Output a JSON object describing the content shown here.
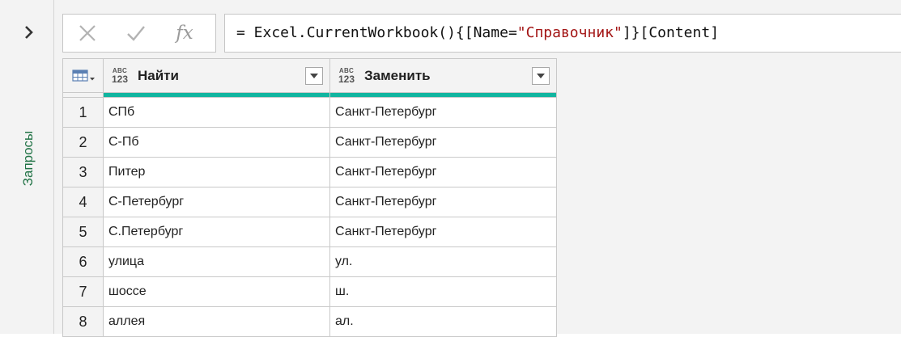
{
  "sidebar": {
    "label": "Запросы",
    "expand_icon": "chevron-right-icon"
  },
  "formula_bar": {
    "cancel_icon": "close-icon",
    "accept_icon": "check-icon",
    "fx_label": "fx",
    "prefix": "= Excel.CurrentWorkbook(){[Name=",
    "string_literal": "\"Справочник\"",
    "suffix": "]}[Content]"
  },
  "table": {
    "corner_icon": "table-menu-icon",
    "type_icon_top": "ABC",
    "type_icon_bottom": "123",
    "columns": [
      {
        "name": "Найти"
      },
      {
        "name": "Заменить"
      }
    ],
    "rows": [
      {
        "n": "1",
        "find": "СПб",
        "replace": "Санкт-Петербург"
      },
      {
        "n": "2",
        "find": "С-Пб",
        "replace": "Санкт-Петербург"
      },
      {
        "n": "3",
        "find": "Питер",
        "replace": "Санкт-Петербург"
      },
      {
        "n": "4",
        "find": "С-Петербург",
        "replace": "Санкт-Петербург"
      },
      {
        "n": "5",
        "find": "С.Петербург",
        "replace": "Санкт-Петербург"
      },
      {
        "n": "6",
        "find": "улица",
        "replace": "ул."
      },
      {
        "n": "7",
        "find": "шоссе",
        "replace": "ш."
      },
      {
        "n": "8",
        "find": "аллея",
        "replace": "ал."
      }
    ]
  },
  "colors": {
    "accent_green": "#217346",
    "quality_bar": "#11b5a0",
    "string_red": "#a31515"
  }
}
